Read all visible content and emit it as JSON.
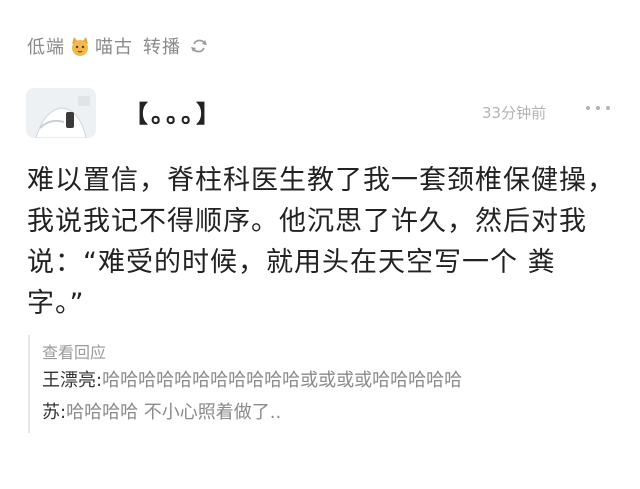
{
  "repost_bar": {
    "user_part1": "低端",
    "user_part2": "喵古",
    "action": "转播",
    "cat_icon": "cat-emoji-icon",
    "repost_icon": "repost-icon"
  },
  "post": {
    "title": "【。。。】",
    "timestamp": "33分钟前",
    "more_icon": "more-dots-icon",
    "body": "难以置信，脊柱科医生教了我一套颈椎保健操，我说我记不得顺序。他沉思了许久，然后对我说：“难受的时候，就用头在天空写一个 粪 字。”"
  },
  "replies": {
    "heading": "查看回应",
    "items": [
      {
        "author": "王漂亮:",
        "content": "哈哈哈哈哈哈哈哈哈哈哈或或或或哈哈哈哈哈"
      },
      {
        "author": "苏:",
        "content": "哈哈哈哈  不小心照着做了.."
      }
    ]
  }
}
